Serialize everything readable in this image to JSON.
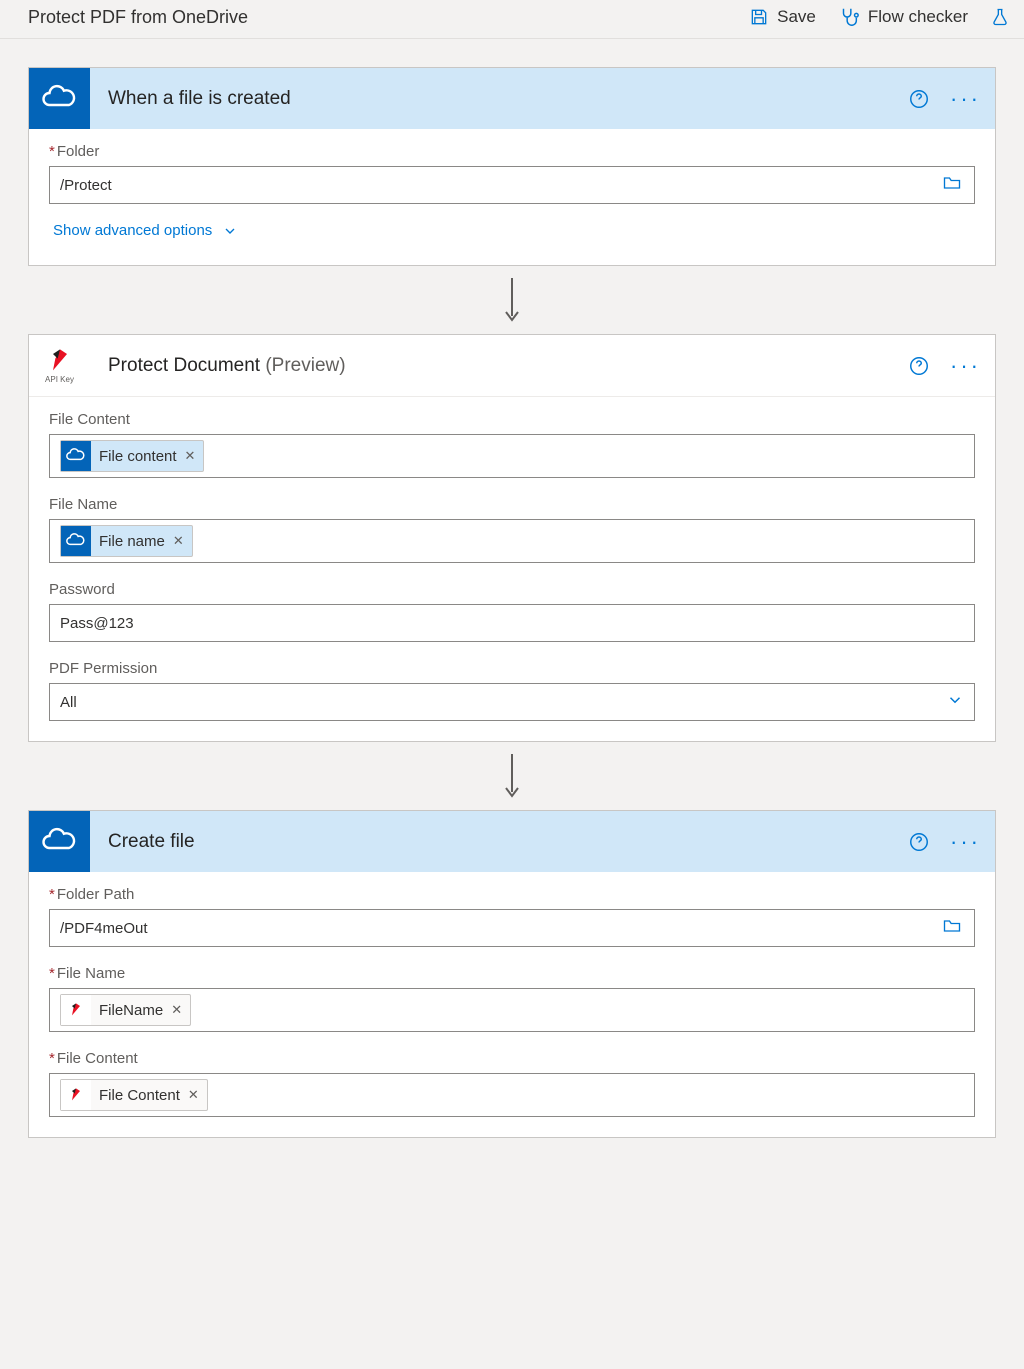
{
  "topbar": {
    "title": "Protect PDF from OneDrive",
    "save": "Save",
    "flow_checker": "Flow checker"
  },
  "step1": {
    "title": "When a file is created",
    "folder_label": "Folder",
    "folder_value": "/Protect",
    "show_advanced": "Show advanced options"
  },
  "step2": {
    "title": "Protect Document",
    "preview": "(Preview)",
    "api_text": "API Key",
    "fields": {
      "file_content_label": "File Content",
      "file_content_token": "File content",
      "file_name_label": "File Name",
      "file_name_token": "File name",
      "password_label": "Password",
      "password_value": "Pass@123",
      "permission_label": "PDF Permission",
      "permission_value": "All"
    }
  },
  "step3": {
    "title": "Create file",
    "fields": {
      "folder_path_label": "Folder Path",
      "folder_path_value": "/PDF4meOut",
      "file_name_label": "File Name",
      "file_name_token": "FileName",
      "file_content_label": "File Content",
      "file_content_token": "File Content"
    }
  }
}
